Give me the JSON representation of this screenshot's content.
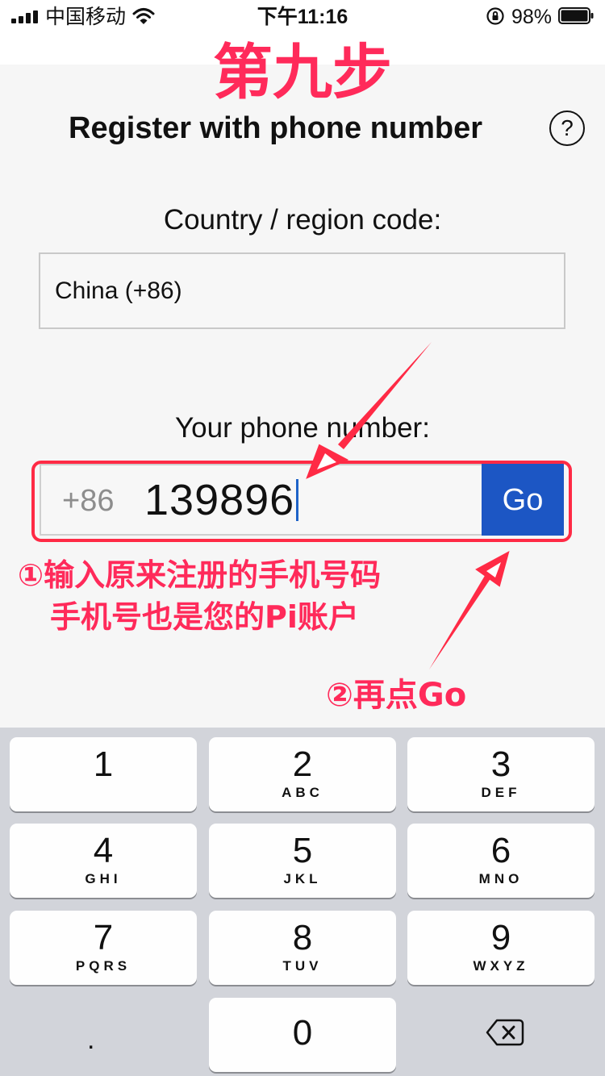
{
  "status_bar": {
    "carrier": "中国移动",
    "time": "下午11:16",
    "battery_percent": "98%",
    "icons": [
      "signal-icon",
      "wifi-icon",
      "orientation-lock-icon",
      "battery-icon"
    ]
  },
  "annotations": {
    "step": "第九步",
    "note_line1": "①输入原来注册的手机号码",
    "note_line2": "手机号也是您的Pi账户",
    "note_go": "②再点Go",
    "color": "#ff2a5a"
  },
  "page": {
    "title": "Register with phone number",
    "help_symbol": "?"
  },
  "country": {
    "label": "Country / region code:",
    "value": "China (+86)"
  },
  "phone": {
    "label": "Your phone number:",
    "prefix": "+86",
    "value": "139896",
    "go_label": "Go",
    "go_color": "#1c56c4"
  },
  "keypad": {
    "keys": [
      {
        "digit": "1",
        "letters": ""
      },
      {
        "digit": "2",
        "letters": "ABC"
      },
      {
        "digit": "3",
        "letters": "DEF"
      },
      {
        "digit": "4",
        "letters": "GHI"
      },
      {
        "digit": "5",
        "letters": "JKL"
      },
      {
        "digit": "6",
        "letters": "MNO"
      },
      {
        "digit": "7",
        "letters": "PQRS"
      },
      {
        "digit": "8",
        "letters": "TUV"
      },
      {
        "digit": "9",
        "letters": "WXYZ"
      },
      {
        "digit": "0",
        "letters": ""
      }
    ],
    "dot": ".",
    "delete_icon": "backspace-icon"
  }
}
